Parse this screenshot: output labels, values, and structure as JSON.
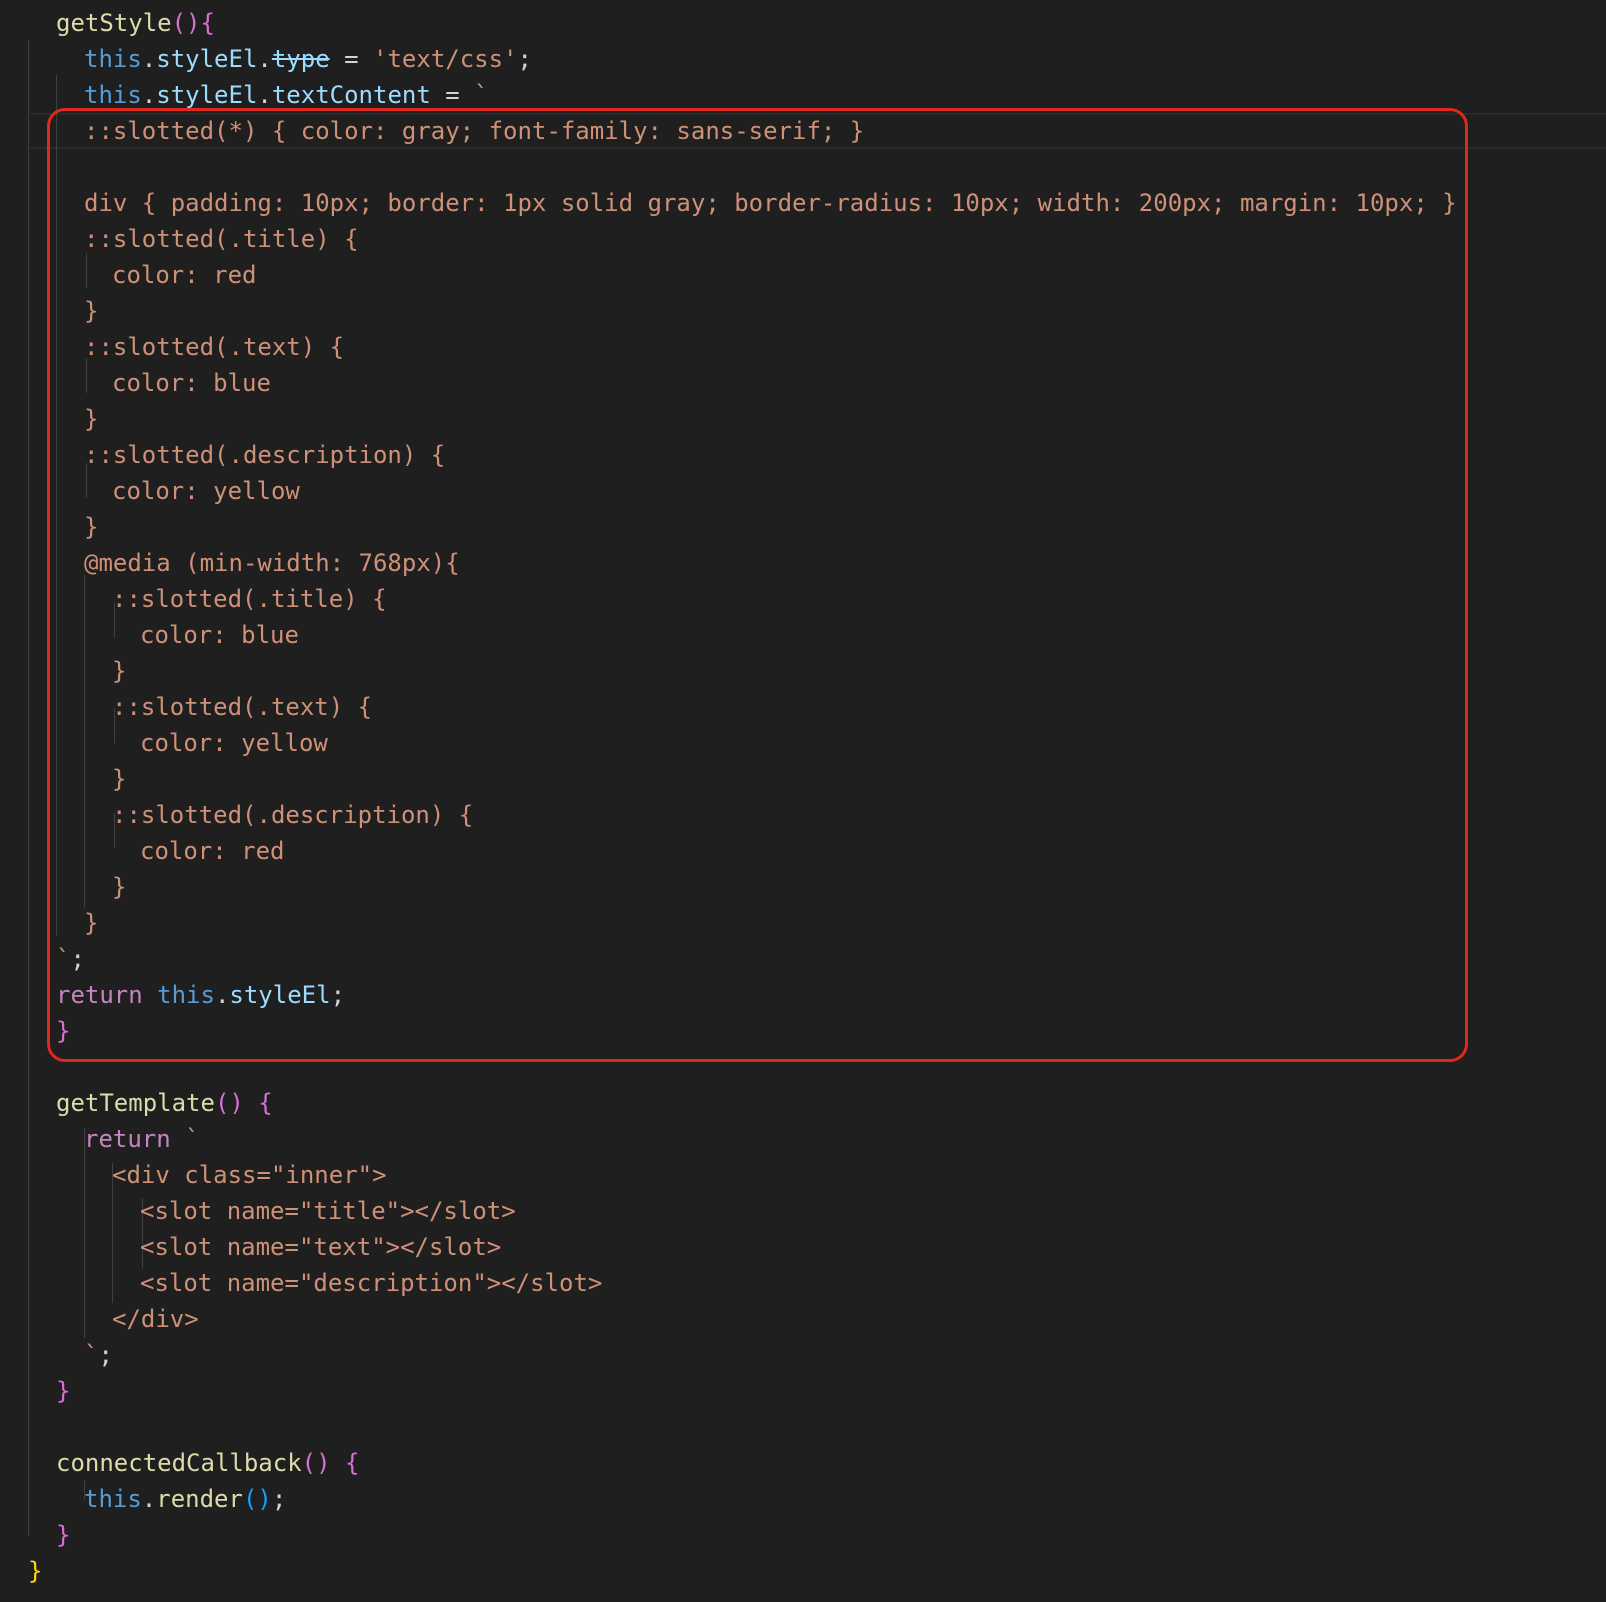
{
  "colors": {
    "background": "#1f1f1f",
    "highlight_box": "#e0281d"
  },
  "code": {
    "lines": [
      [
        {
          "t": "getStyle",
          "c": "k-fn"
        },
        {
          "t": "(){",
          "c": "k-brace-p"
        }
      ],
      [
        {
          "t": "this",
          "c": "k-this"
        },
        {
          "t": ".",
          "c": "k-plain"
        },
        {
          "t": "styleEl",
          "c": "k-prop"
        },
        {
          "t": ".",
          "c": "k-plain"
        },
        {
          "t": "type",
          "c": "k-strike"
        },
        {
          "t": " = ",
          "c": "k-plain"
        },
        {
          "t": "'text/css'",
          "c": "k-str"
        },
        {
          "t": ";",
          "c": "k-plain"
        }
      ],
      [
        {
          "t": "this",
          "c": "k-this"
        },
        {
          "t": ".",
          "c": "k-plain"
        },
        {
          "t": "styleEl",
          "c": "k-prop"
        },
        {
          "t": ".",
          "c": "k-plain"
        },
        {
          "t": "textContent",
          "c": "k-prop"
        },
        {
          "t": " = ",
          "c": "k-plain"
        },
        {
          "t": "`",
          "c": "k-str"
        }
      ],
      [
        {
          "t": "::slotted(*) { color: gray; font-family: sans-serif; }",
          "c": "k-str"
        }
      ],
      [],
      [
        {
          "t": "div { padding: 10px; border: 1px solid gray; border-radius: 10px; width: 200px; margin: 10px; }",
          "c": "k-str"
        }
      ],
      [
        {
          "t": "::slotted(.title) {",
          "c": "k-str"
        }
      ],
      [
        {
          "t": "color: red",
          "c": "k-str"
        }
      ],
      [
        {
          "t": "}",
          "c": "k-str"
        }
      ],
      [
        {
          "t": "::slotted(.text) {",
          "c": "k-str"
        }
      ],
      [
        {
          "t": "color: blue",
          "c": "k-str"
        }
      ],
      [
        {
          "t": "}",
          "c": "k-str"
        }
      ],
      [
        {
          "t": "::slotted(.description) {",
          "c": "k-str"
        }
      ],
      [
        {
          "t": "color: yellow",
          "c": "k-str"
        }
      ],
      [
        {
          "t": "}",
          "c": "k-str"
        }
      ],
      [
        {
          "t": "@media (min-width: 768px){",
          "c": "k-str"
        }
      ],
      [
        {
          "t": "::slotted(.title) {",
          "c": "k-str"
        }
      ],
      [
        {
          "t": "color: blue",
          "c": "k-str"
        }
      ],
      [
        {
          "t": "}",
          "c": "k-str"
        }
      ],
      [
        {
          "t": "::slotted(.text) {",
          "c": "k-str"
        }
      ],
      [
        {
          "t": "color: yellow",
          "c": "k-str"
        }
      ],
      [
        {
          "t": "}",
          "c": "k-str"
        }
      ],
      [
        {
          "t": "::slotted(.description) {",
          "c": "k-str"
        }
      ],
      [
        {
          "t": "color: red",
          "c": "k-str"
        }
      ],
      [
        {
          "t": "}",
          "c": "k-str"
        }
      ],
      [
        {
          "t": "}",
          "c": "k-str"
        }
      ],
      [
        {
          "t": "`",
          "c": "k-str"
        },
        {
          "t": ";",
          "c": "k-plain"
        }
      ],
      [
        {
          "t": "return",
          "c": "k-ctrl"
        },
        {
          "t": " ",
          "c": "k-plain"
        },
        {
          "t": "this",
          "c": "k-this"
        },
        {
          "t": ".",
          "c": "k-plain"
        },
        {
          "t": "styleEl",
          "c": "k-prop"
        },
        {
          "t": ";",
          "c": "k-plain"
        }
      ],
      [
        {
          "t": "}",
          "c": "k-brace-p"
        }
      ],
      [],
      [
        {
          "t": "getTemplate",
          "c": "k-fn"
        },
        {
          "t": "() {",
          "c": "k-brace-p"
        }
      ],
      [
        {
          "t": "return",
          "c": "k-ctrl"
        },
        {
          "t": " `",
          "c": "k-str"
        }
      ],
      [
        {
          "t": "<div class=\"inner\">",
          "c": "k-str"
        }
      ],
      [
        {
          "t": "<slot name=\"title\"></slot>",
          "c": "k-str"
        }
      ],
      [
        {
          "t": "<slot name=\"text\"></slot>",
          "c": "k-str"
        }
      ],
      [
        {
          "t": "<slot name=\"description\"></slot>",
          "c": "k-str"
        }
      ],
      [
        {
          "t": "</div>",
          "c": "k-str"
        }
      ],
      [
        {
          "t": "`",
          "c": "k-str"
        },
        {
          "t": ";",
          "c": "k-plain"
        }
      ],
      [
        {
          "t": "}",
          "c": "k-brace-p"
        }
      ],
      [],
      [
        {
          "t": "connectedCallback",
          "c": "k-fn"
        },
        {
          "t": "() {",
          "c": "k-brace-p"
        }
      ],
      [
        {
          "t": "this",
          "c": "k-this"
        },
        {
          "t": ".",
          "c": "k-plain"
        },
        {
          "t": "render",
          "c": "k-fn"
        },
        {
          "t": "()",
          "c": "k-brace-b"
        },
        {
          "t": ";",
          "c": "k-plain"
        }
      ],
      [
        {
          "t": "}",
          "c": "k-brace-p"
        }
      ],
      [
        {
          "t": "}",
          "c": "k-brace-y"
        }
      ]
    ]
  }
}
